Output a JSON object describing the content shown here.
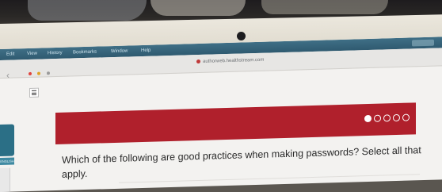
{
  "menubar": {
    "items": [
      "Edit",
      "View",
      "History",
      "Bookmarks",
      "Window",
      "Help"
    ]
  },
  "browser": {
    "url": "authorweb.healthstream.com"
  },
  "course": {
    "left_tab_label": "ENGLISH",
    "progress": {
      "current": 1,
      "total": 5
    },
    "question": "Which of the following are good practices when making passwords? Select all that apply."
  },
  "colors": {
    "banner": "#b0202c",
    "menubar": "#2f5a70",
    "left_tab": "#2b6f86"
  }
}
